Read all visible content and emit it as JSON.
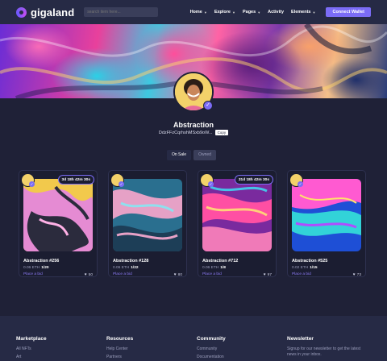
{
  "header": {
    "logo_text": "gigaland",
    "search_placeholder": "search item here...",
    "nav": [
      "Home",
      "Explore",
      "Pages",
      "Activity",
      "Elements"
    ],
    "connect_label": "Connect Wallet"
  },
  "profile": {
    "name": "Abstraction",
    "wallet": "DdzFFzCqrhshMSxb9oW...",
    "copy_label": "Copy",
    "verified_icon": "✓"
  },
  "tabs": [
    "On Sale",
    "Owned"
  ],
  "cards": [
    {
      "title": "Abstraction #256",
      "price": "0.06 ETH",
      "edition": "1/20",
      "bid_label": "Place a bid",
      "likes": "50",
      "countdown": "3d  18h  42m  30s"
    },
    {
      "title": "Abstraction #128",
      "price": "0.06 ETH",
      "edition": "1/22",
      "bid_label": "Place a bid",
      "likes": "80",
      "countdown": ""
    },
    {
      "title": "Abstraction #712",
      "price": "0.06 ETH",
      "edition": "1/8",
      "bid_label": "Place a bid",
      "likes": "97",
      "countdown": "31d  18h  42m  30s"
    },
    {
      "title": "Abstraction #525",
      "price": "0.02 ETH",
      "edition": "1/15",
      "bid_label": "Place a bid",
      "likes": "73",
      "countdown": ""
    }
  ],
  "footer": {
    "columns": [
      {
        "heading": "Marketplace",
        "links": [
          "All NFTs",
          "Art"
        ]
      },
      {
        "heading": "Resources",
        "links": [
          "Help Center",
          "Partners"
        ]
      },
      {
        "heading": "Community",
        "links": [
          "Community",
          "Documentation"
        ]
      }
    ],
    "newsletter_heading": "Newsletter",
    "newsletter_text": "Signup for our newsletter to get the latest news in your inbox."
  },
  "colors": {
    "accent": "#7b6cf6",
    "background": "#1f2137",
    "header_bg": "#262a45"
  },
  "icons": [
    "logo-icon",
    "chevron-down-icon",
    "verified-icon",
    "heart-icon"
  ]
}
